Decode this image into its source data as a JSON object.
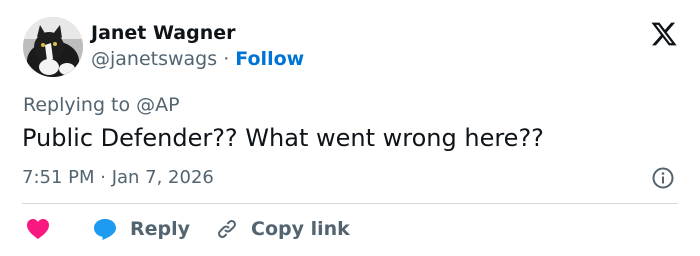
{
  "author": {
    "name": "Janet Wagner",
    "handle": "@janetswags",
    "separator": "·",
    "follow_label": "Follow"
  },
  "reply_context": {
    "prefix": "Replying to",
    "mention": "@AP"
  },
  "tweet": {
    "text": "Public Defender?? What went wrong here??",
    "timestamp": "7:51 PM · Jan 7, 2026"
  },
  "actions": {
    "reply_label": "Reply",
    "copy_link_label": "Copy link"
  },
  "colors": {
    "accent": "#0074d4",
    "heart": "#f91880",
    "reply_bubble": "#1d9bf0",
    "muted_text": "#536471",
    "primary_text": "#0f1419"
  },
  "icons": [
    "avatar-cat",
    "x-logo-icon",
    "info-icon",
    "heart-icon",
    "reply-bubble-icon",
    "link-icon"
  ]
}
